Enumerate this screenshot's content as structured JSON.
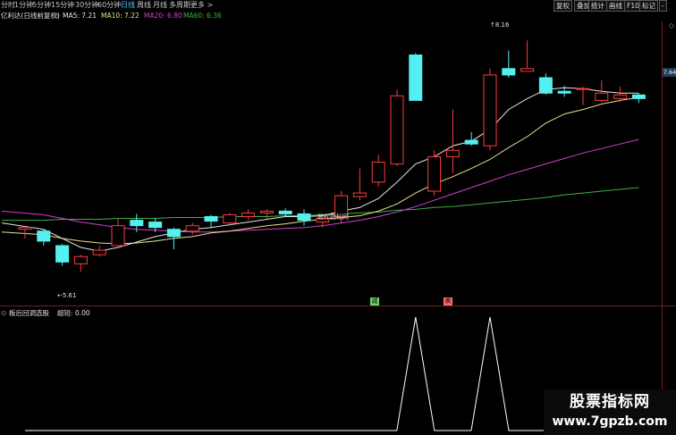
{
  "timeframes": {
    "items": [
      "分时",
      "1分钟",
      "5分钟",
      "15分钟",
      "30分钟",
      "60分钟",
      "日线",
      "周线",
      "月线",
      "多周期",
      "更多 >"
    ],
    "active": "日线"
  },
  "toolbar": {
    "restore": "复权",
    "overlay": "叠加",
    "stats": "统计",
    "draw": "画线",
    "f10": "F10",
    "mark": "标记",
    "minus": "-"
  },
  "stock_label": "亿利达(日线前复权)",
  "ma_legend": {
    "ma5": "MA5: 7.21",
    "ma10": "MA10: 7.22",
    "ma20": "MA20: 6.80",
    "ma60": "MA60: 6.36"
  },
  "annotations": {
    "high": "8.16",
    "low": "5.61",
    "note": "股标指标网"
  },
  "signals": {
    "buy": "减",
    "sell": "卖"
  },
  "indicator": {
    "name": "板后回调选股",
    "param": "超短: 0.00"
  },
  "right_axis": {
    "price": "7.64",
    "corner_icon": "◇"
  },
  "watermark": {
    "line1": "股票指标网",
    "line2": "www.7gpzb.com"
  },
  "colors": {
    "up": "#ff3b3b",
    "down": "#54f0f0",
    "ma5": "#e6e6e6",
    "ma10": "#e8e08a",
    "ma20": "#d040d0",
    "ma60": "#3cb043",
    "indicator": "#ffffff"
  },
  "chart_data": {
    "type": "candlestick",
    "price_range": [
      5.3,
      8.35
    ],
    "candles": [
      {
        "o": 6.08,
        "h": 6.12,
        "l": 5.98,
        "c": 6.1
      },
      {
        "o": 6.06,
        "h": 6.08,
        "l": 5.9,
        "c": 5.95
      },
      {
        "o": 5.9,
        "h": 5.92,
        "l": 5.68,
        "c": 5.72
      },
      {
        "o": 5.7,
        "h": 5.8,
        "l": 5.61,
        "c": 5.78
      },
      {
        "o": 5.8,
        "h": 5.9,
        "l": 5.78,
        "c": 5.85
      },
      {
        "o": 5.9,
        "h": 6.2,
        "l": 5.88,
        "c": 6.12
      },
      {
        "o": 6.18,
        "h": 6.25,
        "l": 6.05,
        "c": 6.12
      },
      {
        "o": 6.16,
        "h": 6.2,
        "l": 6.05,
        "c": 6.1
      },
      {
        "o": 6.08,
        "h": 6.1,
        "l": 5.86,
        "c": 6.0
      },
      {
        "o": 6.06,
        "h": 6.15,
        "l": 6.02,
        "c": 6.12
      },
      {
        "o": 6.22,
        "h": 6.24,
        "l": 6.1,
        "c": 6.17
      },
      {
        "o": 6.15,
        "h": 6.26,
        "l": 6.12,
        "c": 6.24
      },
      {
        "o": 6.22,
        "h": 6.3,
        "l": 6.18,
        "c": 6.26
      },
      {
        "o": 6.26,
        "h": 6.3,
        "l": 6.2,
        "c": 6.28
      },
      {
        "o": 6.28,
        "h": 6.31,
        "l": 6.22,
        "c": 6.25
      },
      {
        "o": 6.25,
        "h": 6.3,
        "l": 6.12,
        "c": 6.18
      },
      {
        "o": 6.16,
        "h": 6.22,
        "l": 6.1,
        "c": 6.2
      },
      {
        "o": 6.22,
        "h": 6.5,
        "l": 6.15,
        "c": 6.45
      },
      {
        "o": 6.44,
        "h": 6.75,
        "l": 6.4,
        "c": 6.48
      },
      {
        "o": 6.6,
        "h": 6.9,
        "l": 6.55,
        "c": 6.82
      },
      {
        "o": 6.8,
        "h": 7.62,
        "l": 6.78,
        "c": 7.55
      },
      {
        "o": 8.0,
        "h": 8.02,
        "l": 7.5,
        "c": 7.5
      },
      {
        "o": 6.5,
        "h": 6.95,
        "l": 6.45,
        "c": 6.88
      },
      {
        "o": 6.88,
        "h": 7.4,
        "l": 6.7,
        "c": 6.95
      },
      {
        "o": 7.06,
        "h": 7.15,
        "l": 7.0,
        "c": 7.02
      },
      {
        "o": 7.0,
        "h": 7.85,
        "l": 6.95,
        "c": 7.78
      },
      {
        "o": 7.85,
        "h": 8.05,
        "l": 7.75,
        "c": 7.78
      },
      {
        "o": 7.82,
        "h": 8.16,
        "l": 7.82,
        "c": 7.85
      },
      {
        "o": 7.75,
        "h": 7.8,
        "l": 7.56,
        "c": 7.58
      },
      {
        "o": 7.6,
        "h": 7.66,
        "l": 7.54,
        "c": 7.58
      },
      {
        "o": 7.63,
        "h": 7.65,
        "l": 7.45,
        "c": 7.63
      },
      {
        "o": 7.5,
        "h": 7.72,
        "l": 7.48,
        "c": 7.58
      },
      {
        "o": 7.52,
        "h": 7.65,
        "l": 7.48,
        "c": 7.56
      },
      {
        "o": 7.56,
        "h": 7.58,
        "l": 7.47,
        "c": 7.52
      }
    ],
    "ma": {
      "ma5": [
        6.15,
        6.08,
        5.98,
        5.88,
        5.84,
        5.88,
        5.94,
        6.0,
        6.04,
        6.08,
        6.1,
        6.13,
        6.16,
        6.19,
        6.22,
        6.22,
        6.23,
        6.28,
        6.32,
        6.42,
        6.6,
        6.8,
        6.88,
        7.0,
        7.05,
        7.18,
        7.4,
        7.52,
        7.62,
        7.64,
        7.63,
        7.6,
        7.58,
        7.58
      ],
      "ma10": [
        6.05,
        6.02,
        5.98,
        5.95,
        5.93,
        5.92,
        5.93,
        5.95,
        5.98,
        6.0,
        6.04,
        6.06,
        6.09,
        6.12,
        6.14,
        6.17,
        6.19,
        6.21,
        6.23,
        6.28,
        6.36,
        6.48,
        6.58,
        6.66,
        6.75,
        6.85,
        6.98,
        7.1,
        7.25,
        7.35,
        7.4,
        7.46,
        7.5,
        7.53
      ],
      "ma20": [
        6.28,
        6.24,
        6.2,
        6.16,
        6.13,
        6.1,
        6.08,
        6.07,
        6.06,
        6.05,
        6.05,
        6.06,
        6.07,
        6.08,
        6.09,
        6.1,
        6.12,
        6.15,
        6.18,
        6.22,
        6.27,
        6.33,
        6.4,
        6.47,
        6.54,
        6.61,
        6.68,
        6.74,
        6.8,
        6.86,
        6.92,
        6.97,
        7.02,
        7.07
      ],
      "ma60": [
        6.18,
        6.18,
        6.19,
        6.19,
        6.19,
        6.2,
        6.2,
        6.2,
        6.21,
        6.21,
        6.21,
        6.22,
        6.22,
        6.22,
        6.23,
        6.23,
        6.24,
        6.25,
        6.26,
        6.27,
        6.29,
        6.3,
        6.32,
        6.33,
        6.35,
        6.37,
        6.39,
        6.41,
        6.43,
        6.46,
        6.48,
        6.5,
        6.52,
        6.54
      ]
    },
    "indicator_values": [
      0,
      0,
      0,
      0,
      0,
      0,
      0,
      0,
      0,
      0,
      0,
      0,
      0,
      0,
      0,
      0,
      0,
      0,
      0,
      0,
      0,
      1,
      0,
      0,
      0,
      1,
      0,
      0,
      0,
      0,
      0,
      0,
      0,
      0
    ],
    "signal_candles": {
      "buy": 21,
      "sell": 25
    }
  }
}
